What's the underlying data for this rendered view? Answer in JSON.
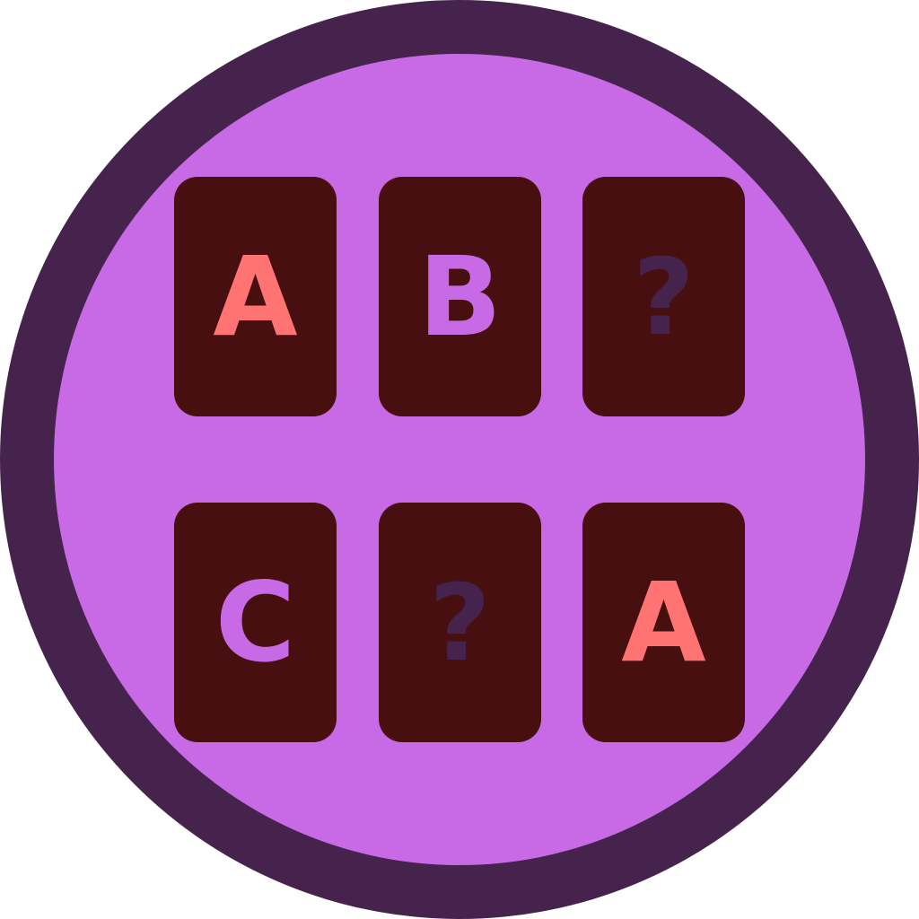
{
  "colors": {
    "ring": "#45234d",
    "face": "#c86ae6",
    "card": "#470f0f",
    "letter_a": "#ff7373",
    "letter_bc": "#c86ae6",
    "hidden_mark": "#45234d"
  },
  "board": {
    "cards": [
      {
        "symbol": "A",
        "state": "revealed"
      },
      {
        "symbol": "B",
        "state": "revealed"
      },
      {
        "symbol": "?",
        "state": "hidden"
      },
      {
        "symbol": "C",
        "state": "revealed"
      },
      {
        "symbol": "?",
        "state": "hidden"
      },
      {
        "symbol": "A",
        "state": "revealed"
      }
    ]
  }
}
